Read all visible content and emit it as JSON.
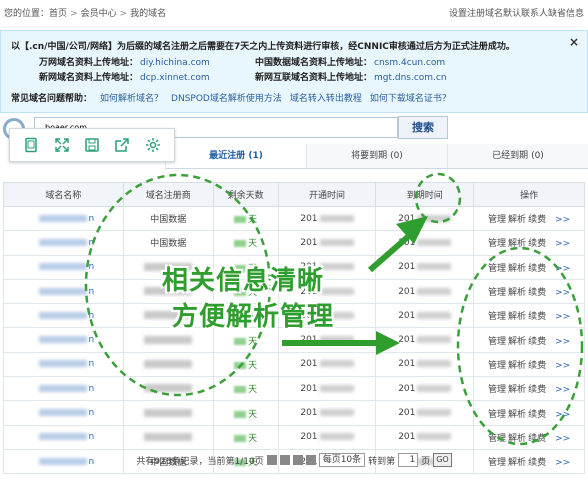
{
  "topbar": {
    "crumb_prefix": "您的位置：",
    "crumbs": [
      "首页",
      "会员中心",
      "我的域名"
    ],
    "right_text": "设置注册域名默认联系人缺省信息"
  },
  "notice": {
    "line1": "以【.cn/中国/公司/网络】为后缀的域名注册之后需要在7天之内上传资料进行审核，经CNNIC审核通过后方为正式注册成功。",
    "close_label": "×",
    "upload": [
      {
        "label": "万网域名资料上传地址：",
        "url": "diy.hichina.com"
      },
      {
        "label": "中国数据域名资料上传地址：",
        "url": "cnsm.4cun.com"
      },
      {
        "label": "新网域名资料上传地址：",
        "url": "dcp.xinnet.com"
      },
      {
        "label": "新网互联域名资料上传地址：",
        "url": "mgt.dns.com.cn"
      }
    ],
    "faq_label": "常见域名问题帮助：",
    "faq_links": [
      "如何解析域名？",
      "DNSPOD域名解析使用方法",
      "域名转入转出教程",
      "如何下载域名证书？"
    ]
  },
  "search": {
    "value": "boaer.com",
    "button_label": "搜索"
  },
  "tabs": [
    {
      "label": "最近注册",
      "count": "(1)",
      "active": true
    },
    {
      "label": "将要到期",
      "count": "(0)",
      "active": false
    },
    {
      "label": "已经到期",
      "count": "(0)",
      "active": false
    }
  ],
  "table": {
    "headers": [
      "域名名称",
      "域名注册商",
      "剩余天数",
      "开通时间",
      "到期时间",
      "操作"
    ],
    "rows": [
      {
        "name_tail": "n",
        "registrar": "中国数据",
        "days": "天",
        "start": "201",
        "end": "201"
      },
      {
        "name_tail": "n",
        "registrar": "中国数据",
        "days": "天",
        "start": "201",
        "end": "201"
      },
      {
        "name_tail": "n",
        "registrar": "",
        "days": "天",
        "start": "201",
        "end": "201"
      },
      {
        "name_tail": "n",
        "registrar": "",
        "days": "天",
        "start": "201",
        "end": "201"
      },
      {
        "name_tail": "n",
        "registrar": "",
        "days": "天",
        "start": "201",
        "end": "201"
      },
      {
        "name_tail": "n",
        "registrar": "",
        "days": "天",
        "start": "201",
        "end": "201"
      },
      {
        "name_tail": "n",
        "registrar": "",
        "days": "天",
        "start": "201",
        "end": "201"
      },
      {
        "name_tail": "n",
        "registrar": "",
        "days": "天",
        "start": "201",
        "end": "201"
      },
      {
        "name_tail": "n",
        "registrar": "",
        "days": "天",
        "start": "201",
        "end": "201"
      },
      {
        "name_tail": "n",
        "registrar": "",
        "days": "天",
        "start": "201",
        "end": "201"
      },
      {
        "name_tail": "n",
        "registrar": "中国数据",
        "days": "天",
        "start": "201",
        "end": "201"
      }
    ],
    "ops": [
      "管理",
      "解析",
      "续费"
    ],
    "more": ">>"
  },
  "pager": {
    "summary": "共有926条记录，当前第1/10页",
    "per_page": "每页10条",
    "goto_label": "转到第",
    "page_value": "1",
    "page_unit": "页",
    "go_label": "GO"
  },
  "promo": {
    "line1": "相关信息清晰",
    "line2": "方便解析管理"
  },
  "colors": {
    "accent": "#1f5fa8",
    "promo_green": "#2f9e2f",
    "notice_bg": "#e8f6fd"
  }
}
